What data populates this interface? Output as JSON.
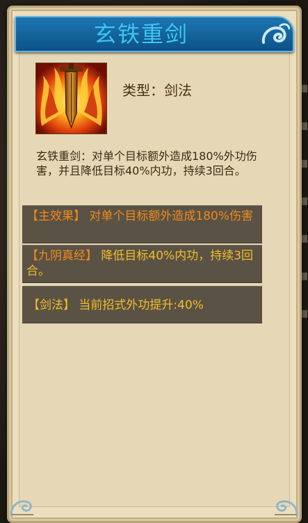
{
  "title": "玄铁重剑",
  "skill_type": "类型：剑法",
  "description": "玄铁重剑：对单个目标额外造成180%外功伤害，并且降低目标40%内功，持续3回合。",
  "effects": [
    {
      "tag": "【主效果】",
      "text": " 对单个目标额外造成180%伤害"
    },
    {
      "tag": "【九阴真经】",
      "text": " 降低目标40%内功，持续3回合。"
    },
    {
      "tag": "【剑法】",
      "text": " 当前招式外功提升:40%"
    }
  ],
  "icons": {
    "skill": "flaming-sword-icon",
    "title_ornament": "swirl-icon",
    "corners": "scroll-corner-icon"
  },
  "colors": {
    "title_bar": "#0d5288",
    "title_text": "#3fc3f5",
    "panel": "#ebdfc0",
    "effect_bg": "#5a5244",
    "orange": "#f08a1e",
    "gold": "#f3bd2b"
  }
}
